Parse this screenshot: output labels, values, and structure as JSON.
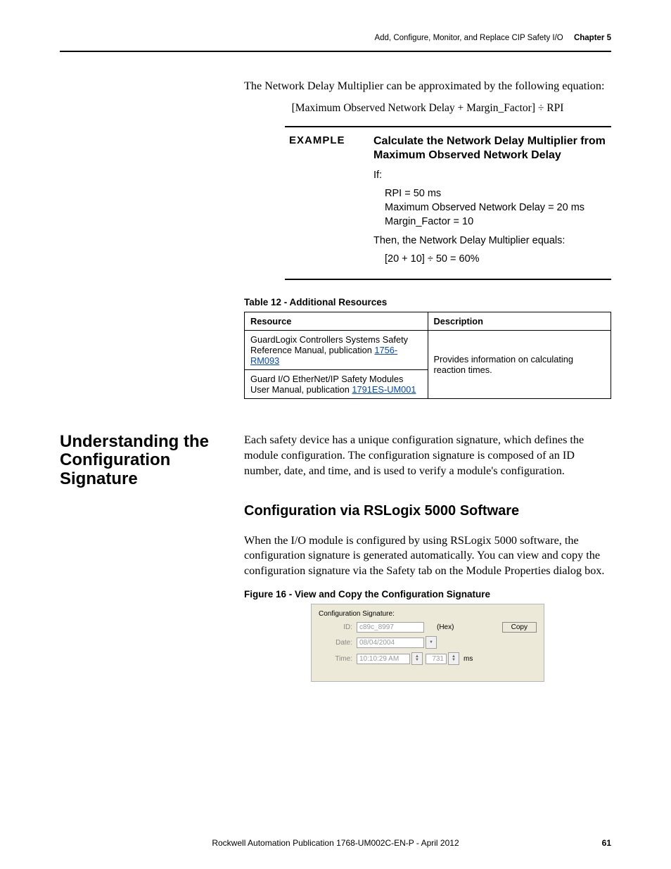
{
  "header": {
    "title": "Add, Configure, Monitor, and Replace CIP Safety I/O",
    "chapter": "Chapter 5"
  },
  "intro": {
    "line1": "The Network Delay Multiplier can be approximated by the following equation:",
    "formula": "[Maximum Observed Network Delay + Margin_Factor] ÷ RPI"
  },
  "example": {
    "label": "EXAMPLE",
    "title": "Calculate the Network Delay Multiplier from Maximum Observed Network Delay",
    "if": "If:",
    "given1": "RPI = 50 ms",
    "given2": "Maximum Observed Network Delay = 20 ms",
    "given3": "Margin_Factor = 10",
    "then": "Then, the Network Delay Multiplier equals:",
    "result": "[20 + 10] ÷ 50 = 60%"
  },
  "table12": {
    "caption": "Table 12 - Additional Resources",
    "headers": {
      "c1": "Resource",
      "c2": "Description"
    },
    "rows": [
      {
        "resource_pre": "GuardLogix Controllers Systems Safety Reference Manual, publication ",
        "pub": "1756-RM093"
      },
      {
        "resource_pre": "Guard I/O EtherNet/IP Safety Modules User Manual, publication ",
        "pub": "1791ES-UM001"
      }
    ],
    "description": "Provides information on calculating reaction times."
  },
  "section": {
    "heading": "Understanding the Configuration Signature",
    "para": "Each safety device has a unique configuration signature, which defines the module configuration. The configuration signature is composed of an ID number, date, and time, and is used to verify a module's configuration."
  },
  "subsection": {
    "heading": "Configuration via RSLogix 5000 Software",
    "para": "When the I/O module is configured by using RSLogix 5000 software, the configuration signature is generated automatically. You can view and copy the configuration signature via the Safety tab on the Module Properties dialog box."
  },
  "figure16": {
    "caption": "Figure 16 - View and Copy the Configuration Signature",
    "title": "Configuration Signature:",
    "id_label": "ID:",
    "id_value": "c89c_8997",
    "hex_label": "(Hex)",
    "copy_label": "Copy",
    "date_label": "Date:",
    "date_value": "08/04/2004",
    "time_label": "Time:",
    "time_value": "10:10:29 AM",
    "ms_value": "731",
    "ms_label": "ms"
  },
  "footer": {
    "text": "Rockwell Automation Publication 1768-UM002C-EN-P - April 2012",
    "page": "61"
  }
}
